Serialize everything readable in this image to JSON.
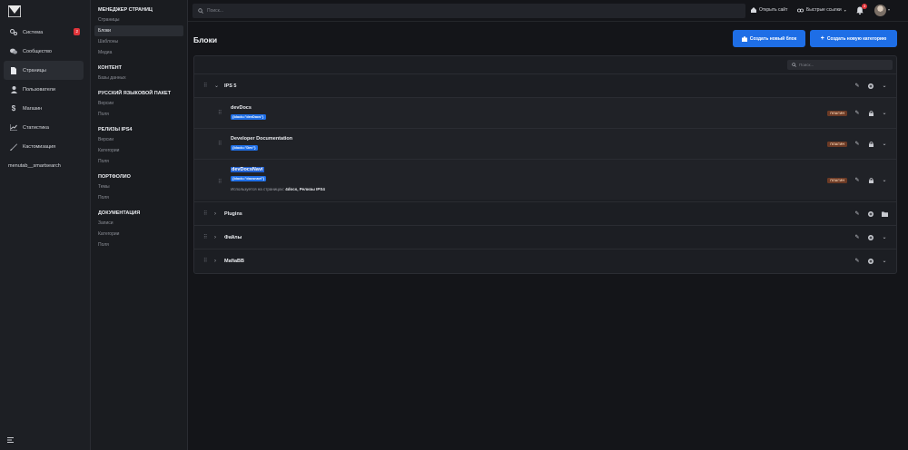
{
  "rail": {
    "items": [
      {
        "label": "Система",
        "icon": "gears-icon",
        "badge": "2",
        "active": false
      },
      {
        "label": "Сообщество",
        "icon": "chat-icon",
        "badge": "",
        "active": false
      },
      {
        "label": "Страницы",
        "icon": "page-icon",
        "badge": "",
        "active": true
      },
      {
        "label": "Пользователи",
        "icon": "user-icon",
        "badge": "",
        "active": false
      },
      {
        "label": "Магазин",
        "icon": "dollar-icon",
        "badge": "",
        "active": false
      },
      {
        "label": "Статистика",
        "icon": "chart-icon",
        "badge": "",
        "active": false
      },
      {
        "label": "Кастомизация",
        "icon": "brush-icon",
        "badge": "",
        "active": false
      },
      {
        "label": "menutab__smartsearch",
        "icon": "",
        "badge": "",
        "active": false
      }
    ]
  },
  "subnav": {
    "sections": [
      {
        "title": "МЕНЕДЖЕР СТРАНИЦ",
        "items": [
          "Страницы",
          "Блоки",
          "Шаблоны",
          "Медиа"
        ],
        "active": "Блоки"
      },
      {
        "title": "КОНТЕНТ",
        "items": [
          "Базы данных"
        ]
      },
      {
        "title": "РУССКИЙ ЯЗЫКОВОЙ ПАКЕТ",
        "items": [
          "Версии",
          "Поля"
        ]
      },
      {
        "title": "РЕЛИЗЫ IPS4",
        "items": [
          "Версии",
          "Категории",
          "Поля"
        ]
      },
      {
        "title": "ПОРТФОЛИО",
        "items": [
          "Темы",
          "Поля"
        ]
      },
      {
        "title": "ДОКУМЕНТАЦИЯ",
        "items": [
          "Записи",
          "Категории",
          "Поля"
        ]
      }
    ]
  },
  "topbar": {
    "search_placeholder": "Поиск...",
    "open_site": "Открыть сайт",
    "quick_links": "Быстрые ссылки",
    "notifications_count": "3"
  },
  "main": {
    "title": "Блоки",
    "create_block": "Создать новый блок",
    "create_category": "Создать новую категорию",
    "filter_placeholder": "Поиск...",
    "categories": [
      {
        "name": "IPS 5",
        "expanded": true,
        "blocks": [
          {
            "name": "devDocs",
            "tag": "{block=\"devDocs\"}",
            "badge": "ПЛАГИН",
            "used_label": "",
            "used_pages": ""
          },
          {
            "name": "Developer Documentation",
            "tag": "{block=\"Dev\"}",
            "badge": "ПЛАГИН",
            "used_label": "",
            "used_pages": ""
          },
          {
            "name": "devDocsNavi",
            "tag": "{block=\"docsnavi\"}",
            "badge": "ПЛАГИН",
            "used_label": "Используется на страницах:",
            "used_pages": "4docs, Релизы IPS4"
          }
        ]
      },
      {
        "name": "Plugins",
        "expanded": false
      },
      {
        "name": "Файлы",
        "expanded": false
      },
      {
        "name": "MafiaBB",
        "expanded": false
      }
    ]
  }
}
